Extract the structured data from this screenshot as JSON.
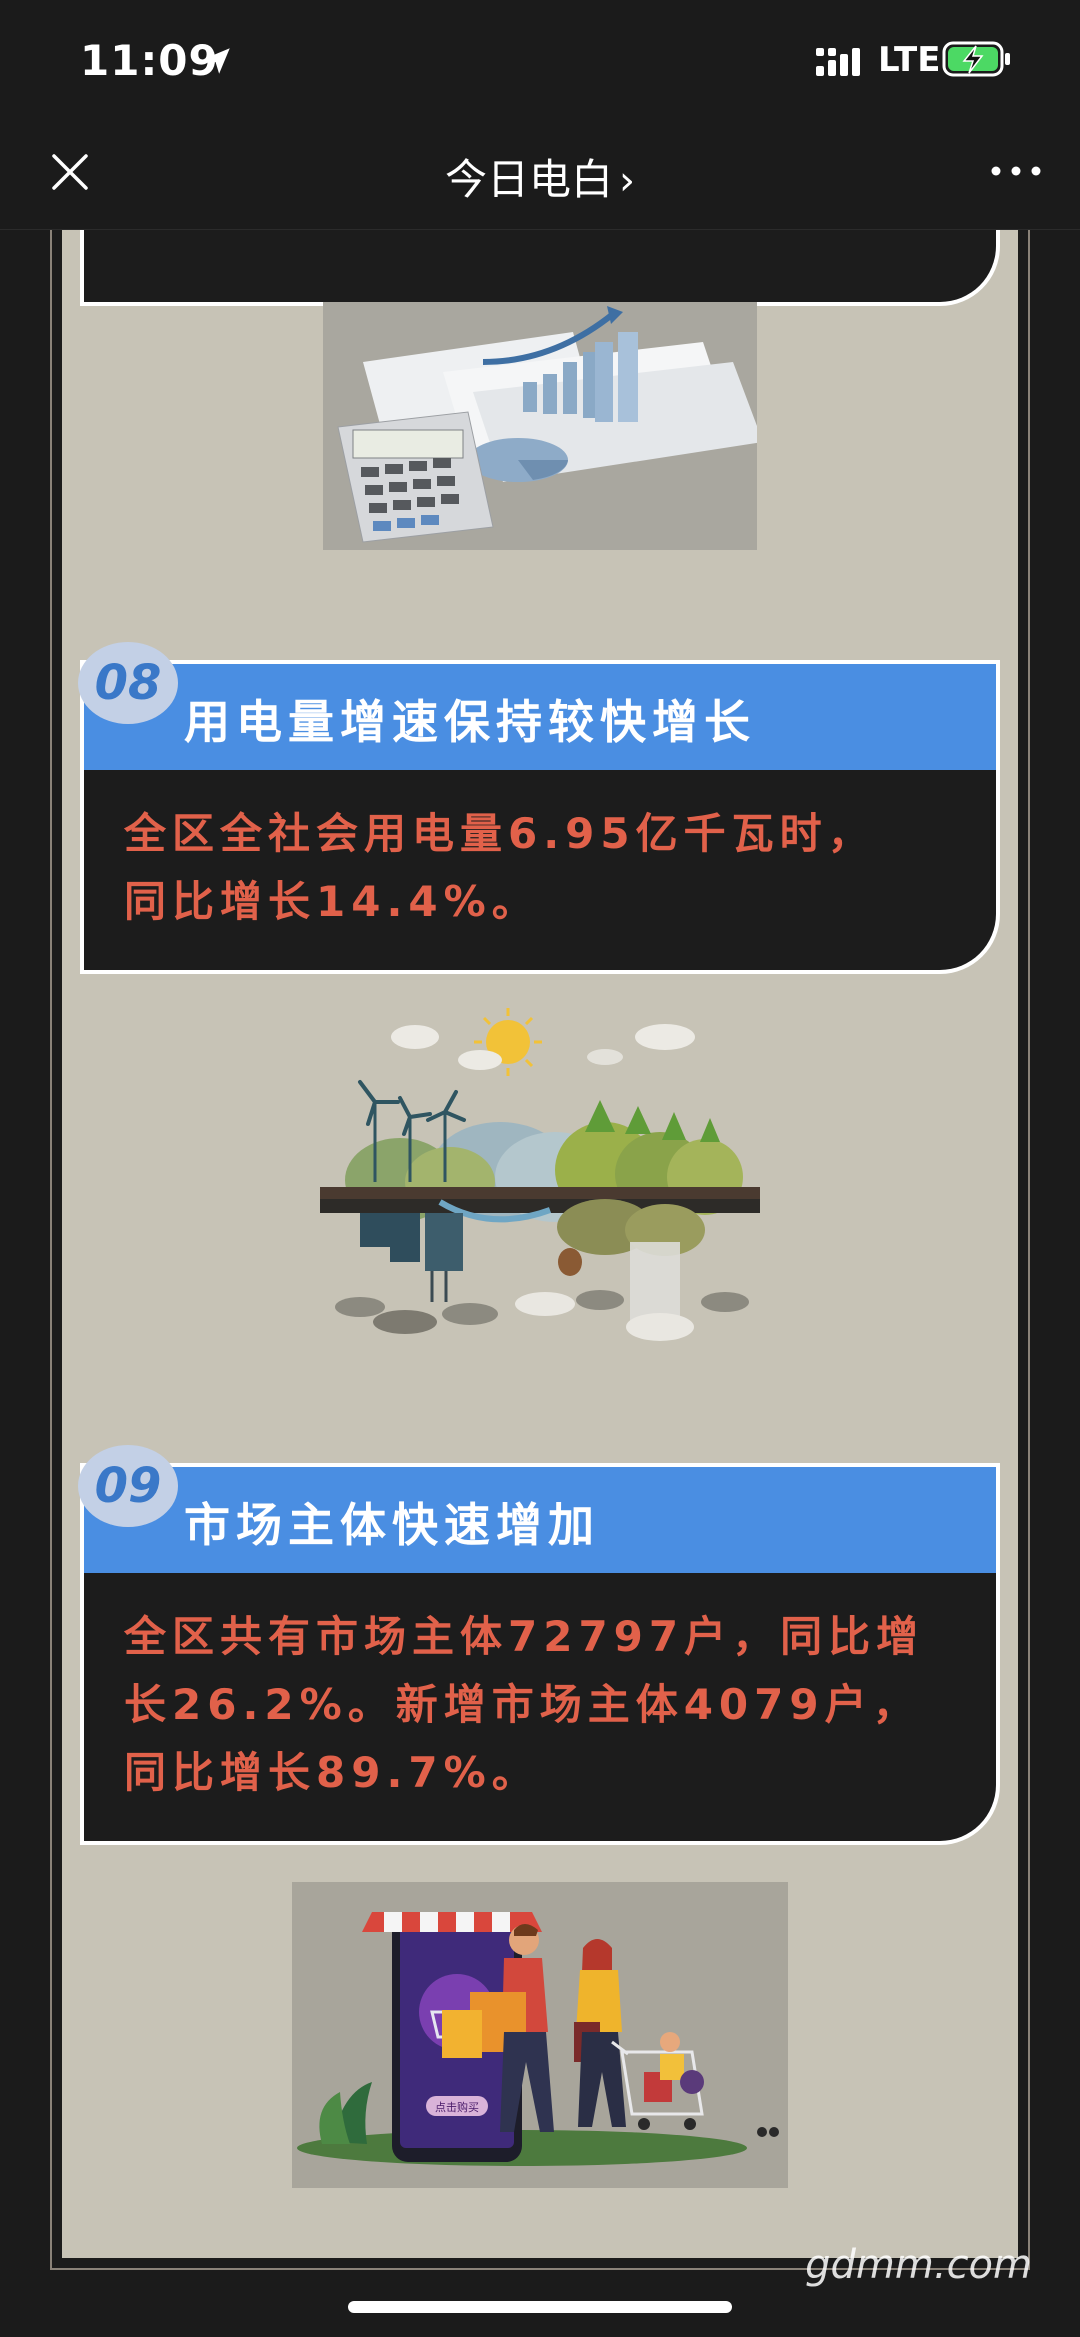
{
  "status_bar": {
    "time": "11:09",
    "network": "LTE"
  },
  "nav": {
    "title": "今日电白"
  },
  "sections": [
    {
      "number": "08",
      "title": "用电量增速保持较快增长",
      "body_lines": [
        "全区全社会用电量6.95亿千瓦时，",
        "同比增长14.4%。"
      ]
    },
    {
      "number": "09",
      "title": "市场主体快速增加",
      "body_lines": [
        "全区共有市场主体72797户，同比增",
        "长26.2%。新增市场主体4079户，",
        "同比增长89.7%。"
      ]
    }
  ],
  "illustrations": {
    "shopping": {
      "phone_button": "点击购买"
    }
  },
  "watermark": "gdmm.com",
  "colors": {
    "accent_blue": "#4a8ee2",
    "text_red": "#e1614a",
    "page_bg": "#c7c3b6"
  }
}
